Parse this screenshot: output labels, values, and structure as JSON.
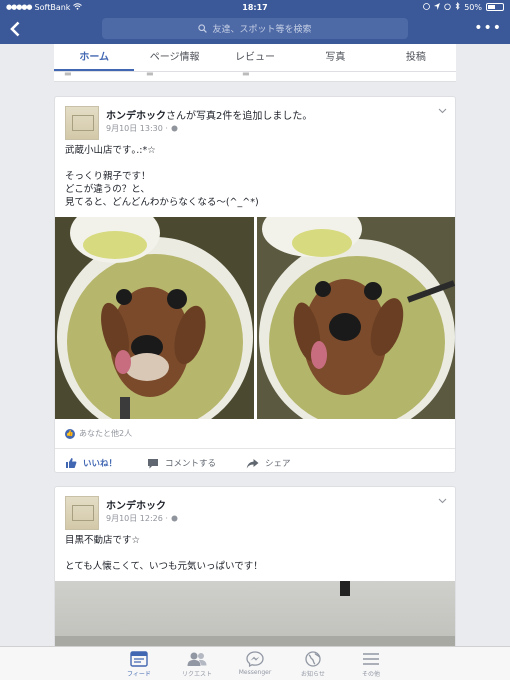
{
  "status_bar": {
    "carrier": "SoftBank",
    "time": "18:17",
    "battery": "50%",
    "battery_level": 0.5
  },
  "nav": {
    "search_placeholder": "友達、スポット等を検索"
  },
  "tabs": [
    {
      "label": "ホーム",
      "active": true
    },
    {
      "label": "ページ情報",
      "active": false
    },
    {
      "label": "レビュー",
      "active": false
    },
    {
      "label": "写真",
      "active": false
    },
    {
      "label": "投稿",
      "active": false
    }
  ],
  "posts": [
    {
      "author": "ホンデホック",
      "action": "さんが写真2件を追加しました。",
      "timestamp": "9月10日 13:30 ·",
      "text": "武蔵小山店です｡.:*☆\n\nそっくり親子です！\nどこが違うの？と、\n見てると、どんどんわからなくなる〜(^_^*)",
      "likes_text": "あなたと他2人",
      "actions": {
        "like": "いいね！",
        "comment": "コメントする",
        "share": "シェア"
      }
    },
    {
      "author": "ホンデホック",
      "timestamp": "9月10日 12:26 ·",
      "text": "目黒不動店です☆\n\nとても人懐こくて、いつも元気いっぱいです！"
    }
  ],
  "bottom_bar": [
    {
      "label": "フィード",
      "icon": "feed-icon",
      "active": true
    },
    {
      "label": "リクエスト",
      "icon": "friends-icon",
      "active": false
    },
    {
      "label": "Messenger",
      "icon": "messenger-icon",
      "active": false
    },
    {
      "label": "お知らせ",
      "icon": "globe-icon",
      "active": false
    },
    {
      "label": "その他",
      "icon": "menu-icon",
      "active": false
    }
  ],
  "colors": {
    "brand": "#3b5998",
    "accent": "#4267b2"
  }
}
